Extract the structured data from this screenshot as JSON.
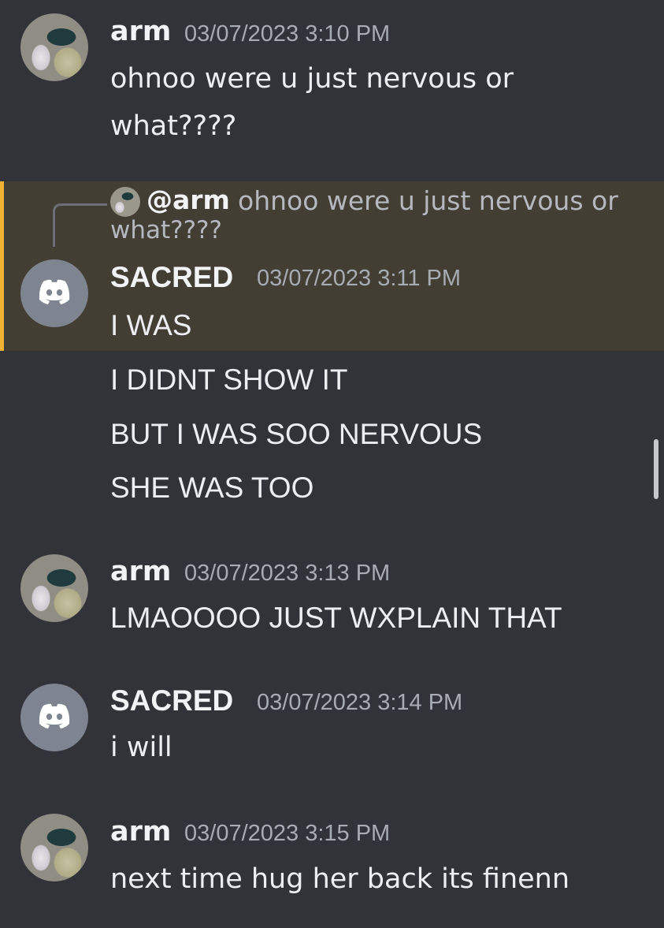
{
  "messages": [
    {
      "author": "arm",
      "timestamp": "03/07/2023 3:10 PM",
      "lines": [
        "ohnoo were u just nervous or",
        "what????"
      ]
    },
    {
      "author": "SACRED",
      "timestamp": "03/07/2023 3:11 PM",
      "reply": {
        "mention": "@arm",
        "text_line1": "ohnoo were u just nervous or",
        "text_line2": "what????"
      },
      "lines": [
        "I WAS",
        "I DIDNT SHOW IT",
        "BUT I WAS SOO NERVOUS",
        "SHE WAS TOO"
      ]
    },
    {
      "author": "arm",
      "timestamp": "03/07/2023 3:13 PM",
      "lines": [
        "LMAOOOO JUST WXPLAIN THAT"
      ]
    },
    {
      "author": "SACRED",
      "timestamp": "03/07/2023 3:14 PM",
      "lines": [
        "i will"
      ]
    },
    {
      "author": "arm",
      "timestamp": "03/07/2023 3:15 PM",
      "lines": [
        "next time hug her back its finenn"
      ]
    }
  ],
  "icons": {
    "arm_avatar": "user-avatar-image",
    "sacred_avatar": "discord-logo-icon"
  },
  "colors": {
    "background": "#313338",
    "reply_highlight": "#433e34",
    "reply_accent": "#f0b232",
    "timestamp": "#a7abb2"
  }
}
